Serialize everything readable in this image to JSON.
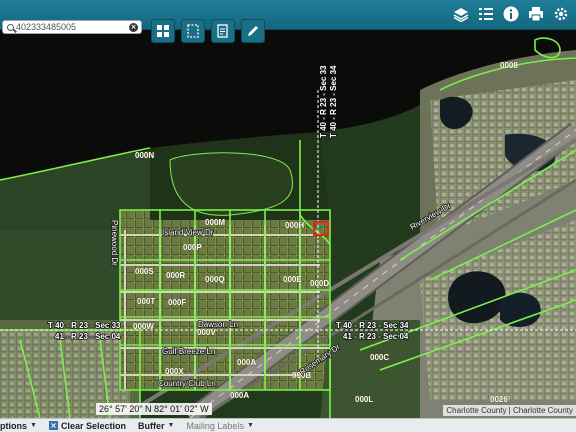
{
  "search": {
    "value": "402333485005"
  },
  "bottom_bar": {
    "options_label": "ptions",
    "clear_selection_label": "Clear Selection",
    "buffer_label": "Buffer",
    "mailing_labels_label": "Mailing Labels"
  },
  "map": {
    "coordinates": "26° 57' 20\" N 82° 01' 02\" W",
    "attribution": "Charlotte County | Charlotte County",
    "parcel_labels": [
      "000N",
      "000M",
      "000H",
      "000P",
      "000S",
      "000R",
      "000Q",
      "000E",
      "000D",
      "000T",
      "000F",
      "000W",
      "000V",
      "000A",
      "000X",
      "000B",
      "000C",
      "000A",
      "0008",
      "0026",
      "000L"
    ],
    "street_labels": [
      "Island View Dr",
      "Dawson Ln",
      "Gulf Breeze Ln",
      "Country Club Ln",
      "Rosemary Dr",
      "Riverview Dr",
      "Pinewood Dr"
    ],
    "township_labels": [
      "T 40 - R 23 - Sec 33",
      "T 40 - R 23 - Sec 34",
      "T 40 - R 23 - Sec 33",
      "41 - R 23 - Sec 04",
      "T 40 - R 23 - Sec 34",
      "41 - R 23 - Sec 04"
    ],
    "selected_parcel_color": "#e8231e",
    "parcel_outline_color": "#7cf04a",
    "lot_line_color": "#f2e84a"
  },
  "toolbar": {
    "left_icons": [
      "grid-icon",
      "select-box-icon",
      "document-edit-icon",
      "pencil-icon"
    ],
    "right_icons": [
      "layers-icon",
      "list-icon",
      "info-icon",
      "print-icon",
      "settings-icon"
    ]
  }
}
